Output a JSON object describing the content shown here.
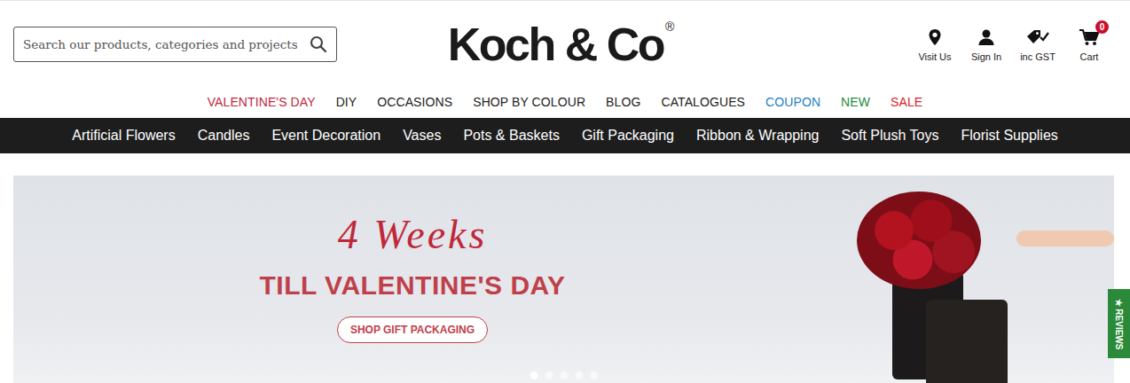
{
  "search": {
    "placeholder": "Search our products, categories and projects"
  },
  "logo": {
    "text": "Koch & Co",
    "mark": "®"
  },
  "header_actions": [
    {
      "label": "Visit Us",
      "kind": "pin"
    },
    {
      "label": "Sign In",
      "kind": "user"
    },
    {
      "label": "inc GST",
      "kind": "tag"
    },
    {
      "label": "Cart",
      "kind": "cart",
      "badge": "0"
    }
  ],
  "top_nav": [
    {
      "label": "VALENTINE'S DAY",
      "color": "#c0283a"
    },
    {
      "label": "DIY",
      "color": "#222222"
    },
    {
      "label": "OCCASIONS",
      "color": "#222222"
    },
    {
      "label": "SHOP BY COLOUR",
      "color": "#222222"
    },
    {
      "label": "BLOG",
      "color": "#222222"
    },
    {
      "label": "CATALOGUES",
      "color": "#222222"
    },
    {
      "label": "COUPON",
      "color": "#1f7fbf"
    },
    {
      "label": "NEW",
      "color": "#1e8a3c"
    },
    {
      "label": "SALE",
      "color": "#d81e2a"
    }
  ],
  "category_nav": [
    "Artificial Flowers",
    "Candles",
    "Event Decoration",
    "Vases",
    "Pots & Baskets",
    "Gift Packaging",
    "Ribbon & Wrapping",
    "Soft Plush Toys",
    "Florist Supplies"
  ],
  "banner": {
    "script": "4 Weeks",
    "headline": "TILL VALENTINE'S DAY",
    "button": "SHOP GIFT PACKAGING",
    "slides": [
      {
        "selected": true
      },
      {
        "selected": false
      },
      {
        "selected": false
      },
      {
        "selected": false
      },
      {
        "selected": false
      }
    ]
  },
  "reviews_tab": {
    "label": "★ REVIEWS"
  }
}
